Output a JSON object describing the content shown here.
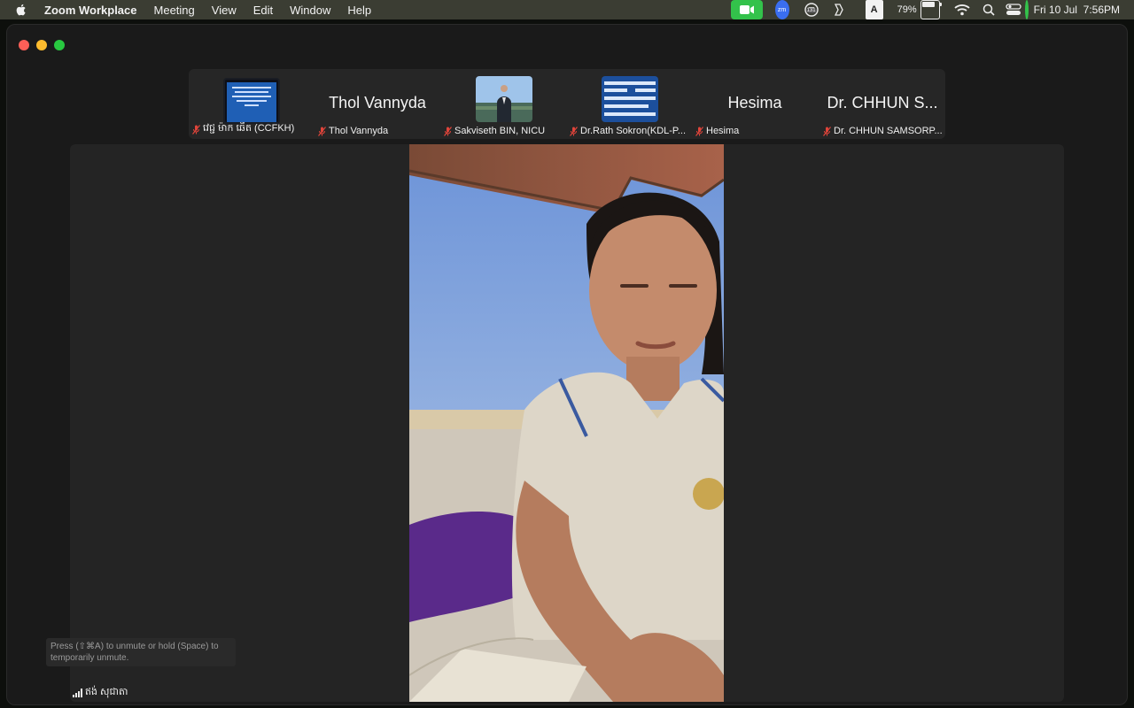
{
  "menubar": {
    "app_name": "Zoom Workplace",
    "items": [
      "Meeting",
      "View",
      "Edit",
      "Window",
      "Help"
    ],
    "zm_badge": "zm",
    "notification_count": "131",
    "input_source": "A",
    "battery_percent": "79%",
    "battery_level": 0.79,
    "date": "Fri 10 Jul",
    "time": "7:56PM"
  },
  "participants": [
    {
      "label": "វេជ្ជ ម៉ាក ឆើត (CCFKH)",
      "display": "thumbnail-slide"
    },
    {
      "label": "Thol Vannyda",
      "display": "name",
      "big_name": "Thol Vannyda"
    },
    {
      "label": "Sakviseth BIN, NICU",
      "display": "thumbnail-photo"
    },
    {
      "label": "Dr.Rath Sokron(KDL-P...",
      "display": "thumbnail-khmer"
    },
    {
      "label": "Hesima",
      "display": "name",
      "big_name": "Hesima"
    },
    {
      "label": "Dr. CHHUN SAMSORP...",
      "display": "name",
      "big_name": "Dr. CHHUN S..."
    }
  ],
  "hint": {
    "line1": "Press (⇧⌘A) to unmute or hold (Space) to",
    "line2": "temporarily unmute."
  },
  "active_speaker": {
    "name": "ឥង់ សុជាតា"
  },
  "colors": {
    "menubar_bg": "#3b3d33",
    "window_bg": "#1a1a1a",
    "stage_bg": "#242424",
    "muted_red": "#e0443a",
    "zoom_green": "#33c24b"
  }
}
